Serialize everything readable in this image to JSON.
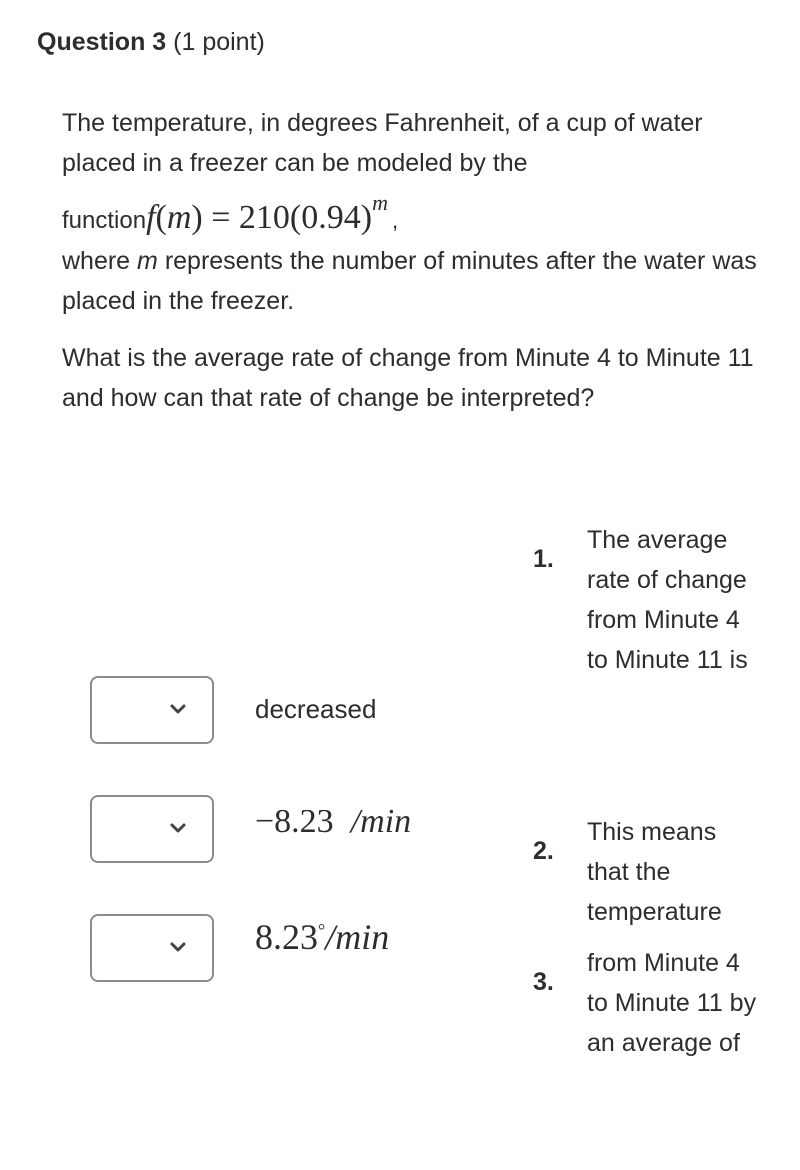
{
  "question": {
    "title": "Question 3",
    "points": "(1 point)"
  },
  "prompt": {
    "line1": "The temperature, in degrees Fahrenheit, of a cup of water placed in a freezer can be modeled by the",
    "function_label": "function",
    "function_math": "f(m) = 210(0.94)",
    "function_lhs_f": "f",
    "function_lhs_open": "(",
    "function_lhs_var": "m",
    "function_rhs": ") = 210(0.94)",
    "function_exponent": "m",
    "function_comma": ",",
    "where_pre": "where ",
    "where_var": "m",
    "where_post": " represents the number of minutes after the water was placed in the freezer.",
    "question_text": "What is the average rate of change from Minute 4 to Minute 11 and how can that rate of change be interpreted?"
  },
  "dropdowns": [
    {
      "selected": "",
      "icon": "chevron-down-icon"
    },
    {
      "selected": "",
      "icon": "chevron-down-icon"
    },
    {
      "selected": "",
      "icon": "chevron-down-icon"
    }
  ],
  "answer_options": [
    {
      "text": "decreased"
    },
    {
      "num": "−8.23",
      "degree": "°",
      "unit": "/min"
    },
    {
      "num": "8.23",
      "degree": "°",
      "unit": "/min"
    }
  ],
  "statements": [
    {
      "number": "1.",
      "text": "The average rate of change from Minute 4 to Minute 11 is"
    },
    {
      "number": "2.",
      "text": "This means that the temperature"
    },
    {
      "number": "3.",
      "text": "from Minute 4 to Minute 11 by an average of"
    }
  ]
}
